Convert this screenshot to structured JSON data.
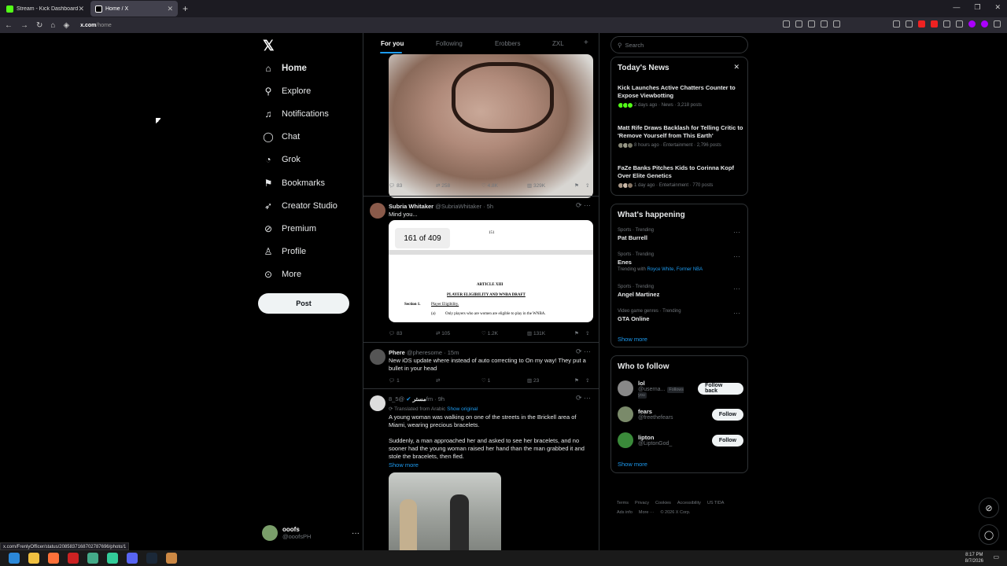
{
  "browser": {
    "tabs": [
      {
        "title": "Stream - Kick Dashboard",
        "color": "#53fc18"
      },
      {
        "title": "Home / X",
        "color": "#ffffff"
      }
    ],
    "url_host": "x.com",
    "url_path": "/home",
    "status_url": "x.com/FrenlyOfficer/status/2085837168702787696/photo/1"
  },
  "nav": {
    "items": [
      {
        "label": "Home",
        "icon": "home-icon",
        "glyph": "⌂"
      },
      {
        "label": "Explore",
        "icon": "search-icon",
        "glyph": "⚲"
      },
      {
        "label": "Notifications",
        "icon": "bell-icon",
        "glyph": "♫"
      },
      {
        "label": "Chat",
        "icon": "chat-icon",
        "glyph": "◯"
      },
      {
        "label": "Grok",
        "icon": "grok-icon",
        "glyph": "◔"
      },
      {
        "label": "Bookmarks",
        "icon": "bookmark-icon",
        "glyph": "⚑"
      },
      {
        "label": "Creator Studio",
        "icon": "rocket-icon",
        "glyph": "➶"
      },
      {
        "label": "Premium",
        "icon": "verified-icon",
        "glyph": "⊘"
      },
      {
        "label": "Profile",
        "icon": "person-icon",
        "glyph": "♙"
      },
      {
        "label": "More",
        "icon": "more-circle-icon",
        "glyph": "⊙"
      }
    ],
    "post_label": "Post",
    "account": {
      "name": "ooofs",
      "handle": "@ooofsPH"
    }
  },
  "feed": {
    "tabs": [
      "For you",
      "Following",
      "Erobbers",
      "ZXL"
    ],
    "add_tab": "+",
    "post0": {
      "replies": "83",
      "reposts": "258",
      "likes": "4.8K",
      "views": "329K"
    },
    "post1": {
      "name": "Subria Whitaker",
      "handle": "@SubriaWhitaker · 5h",
      "text": "Mind you...",
      "doc": {
        "page": "161 of 409",
        "num": "151",
        "article": "ARTICLE XIII",
        "heading": "PLAYER ELIGIBILITY AND WNBA DRAFT",
        "section": "Section 1.",
        "section_title": "Player Eligibility.",
        "clause": "(a)",
        "clause_text": "Only players who are women are eligible to play in the WNBA."
      },
      "replies": "83",
      "reposts": "105",
      "likes": "1.2K",
      "views": "131K"
    },
    "post2": {
      "name": "Phere",
      "handle": "@pheresome · 15m",
      "text": "New iOS update where instead of auto correcting to On my way! They put a bullet in your head",
      "replies": "1",
      "reposts": "",
      "likes": "1",
      "views": "23"
    },
    "post3": {
      "name": "مستر",
      "handle": "@5_8fm · 9h",
      "translated": "Translated from Arabic",
      "show_original": "Show original",
      "text1": "A young woman was walking on one of the streets in the Brickell area of Miami, wearing precious bracelets.",
      "text2": "Suddenly, a man approached her and asked to see her bracelets, and no sooner had the young woman raised her hand than the man grabbed it and stole the bracelets, then fled.",
      "show_more": "Show more"
    }
  },
  "sidebar": {
    "search_placeholder": "Search",
    "news": {
      "title": "Today's News",
      "items": [
        {
          "headline": "Kick Launches Active Chatters Counter to Expose Viewbotting",
          "meta": "2 days ago · News · 3,218 posts"
        },
        {
          "headline": "Matt Rife Draws Backlash for Telling Critic to 'Remove Yourself from This Earth'",
          "meta": "8 hours ago · Entertainment · 2,796 posts"
        },
        {
          "headline": "FaZe Banks Pitches Kids to Corinna Kopf Over Elite Genetics",
          "meta": "1 day ago · Entertainment · 770 posts"
        }
      ]
    },
    "happening": {
      "title": "What's happening",
      "items": [
        {
          "context": "Sports · Trending",
          "name": "Pat Burrell",
          "sub": "",
          "links": ""
        },
        {
          "context": "Sports · Trending",
          "name": "Enes",
          "sub": "Trending with ",
          "links": "Royce White, Former NBA"
        },
        {
          "context": "Sports · Trending",
          "name": "Angel Martinez",
          "sub": "",
          "links": ""
        },
        {
          "context": "Video game genres · Trending",
          "name": "GTA Online",
          "sub": "",
          "links": ""
        }
      ],
      "show_more": "Show more"
    },
    "follow": {
      "title": "Who to follow",
      "items": [
        {
          "name": "lol",
          "handle": "@userna...",
          "badge": "Follows you",
          "button": "Follow back"
        },
        {
          "name": "fears",
          "handle": "@freethefears",
          "badge": "",
          "button": "Follow"
        },
        {
          "name": "lipton",
          "handle": "@LiptonGod_",
          "badge": "",
          "button": "Follow"
        }
      ],
      "show_more": "Show more"
    },
    "footer": {
      "row1": [
        "Terms",
        "Privacy",
        "Cookies",
        "Accessibility",
        "US TIDA"
      ],
      "row2": [
        "Ads info",
        "More ···",
        "© 2026 X Corp."
      ]
    }
  },
  "taskbar": {
    "time": "8:17 PM",
    "date": "8/7/2026"
  }
}
